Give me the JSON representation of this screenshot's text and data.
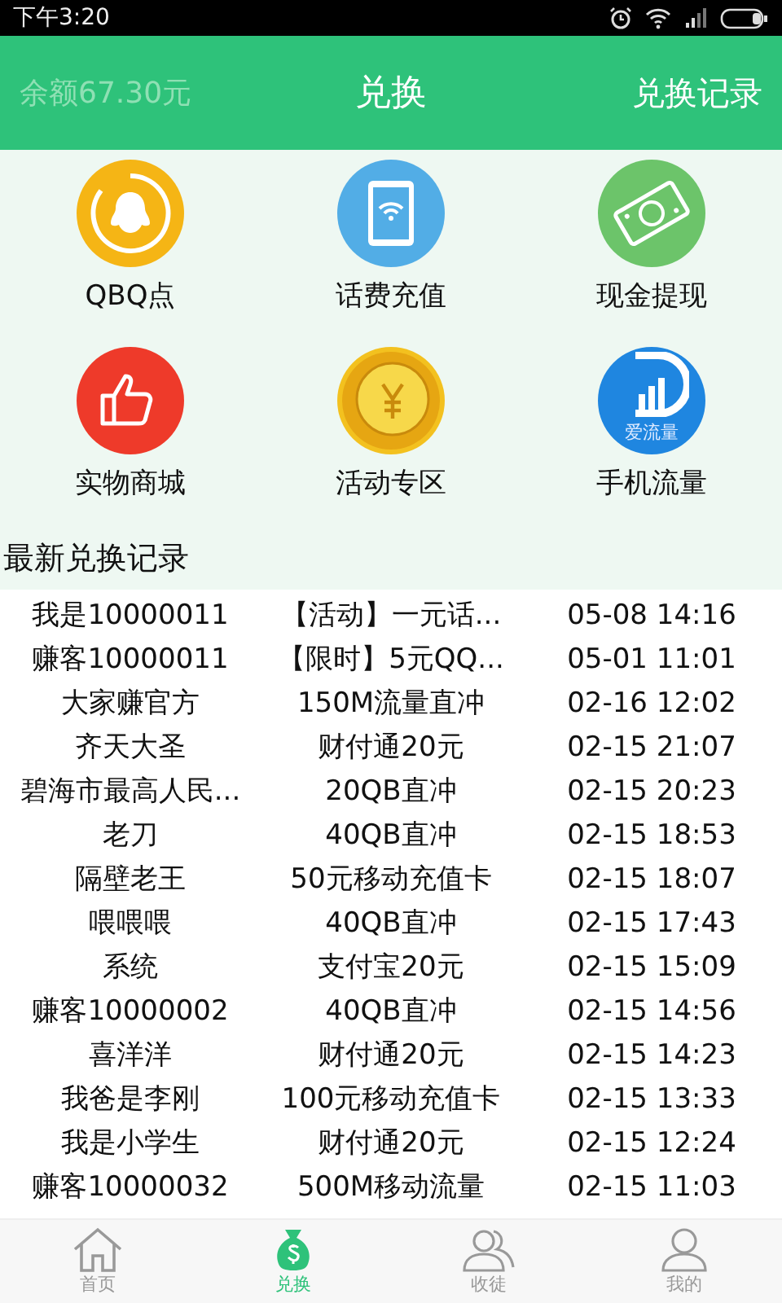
{
  "status_bar": {
    "time": "下午3:20"
  },
  "header": {
    "balance": "余额67.30元",
    "title": "兑换",
    "link": "兑换记录"
  },
  "categories": [
    {
      "label": "QBQ点",
      "kind": "qq",
      "color": "#f5b515"
    },
    {
      "label": "话费充值",
      "kind": "phone",
      "color": "#52ade6"
    },
    {
      "label": "现金提现",
      "kind": "cash",
      "color": "#6cc46a"
    },
    {
      "label": "实物商城",
      "kind": "thumb",
      "color": "#ee3a2a"
    },
    {
      "label": "活动专区",
      "kind": "coin",
      "color": "#f3c11f"
    },
    {
      "label": "手机流量",
      "kind": "data",
      "color": "#1f86e0",
      "caption": "爱流量"
    }
  ],
  "section_title": "最新兑换记录",
  "records": [
    {
      "user": "我是10000011",
      "item": "【活动】一元话...",
      "time": "05-08 14:16"
    },
    {
      "user": "赚客10000011",
      "item": "【限时】5元QQ...",
      "time": "05-01 11:01"
    },
    {
      "user": "大家赚官方",
      "item": "150M流量直冲",
      "time": "02-16 12:02"
    },
    {
      "user": "齐天大圣",
      "item": "财付通20元",
      "time": "02-15 21:07"
    },
    {
      "user": "碧海市最高人民...",
      "item": "20QB直冲",
      "time": "02-15 20:23"
    },
    {
      "user": "老刀",
      "item": "40QB直冲",
      "time": "02-15 18:53"
    },
    {
      "user": "隔壁老王",
      "item": "50元移动充值卡",
      "time": "02-15 18:07"
    },
    {
      "user": "喂喂喂",
      "item": "40QB直冲",
      "time": "02-15 17:43"
    },
    {
      "user": "系统",
      "item": "支付宝20元",
      "time": "02-15 15:09"
    },
    {
      "user": "赚客10000002",
      "item": "40QB直冲",
      "time": "02-15 14:56"
    },
    {
      "user": "喜洋洋",
      "item": "财付通20元",
      "time": "02-15 14:23"
    },
    {
      "user": "我爸是李刚",
      "item": "100元移动充值卡",
      "time": "02-15 13:33"
    },
    {
      "user": "我是小学生",
      "item": "财付通20元",
      "time": "02-15 12:24"
    },
    {
      "user": "赚客10000032",
      "item": "500M移动流量",
      "time": "02-15 11:03"
    }
  ],
  "nav": [
    {
      "label": "首页",
      "kind": "home",
      "selected": false
    },
    {
      "label": "兑换",
      "kind": "bag",
      "selected": true
    },
    {
      "label": "收徒",
      "kind": "people",
      "selected": false
    },
    {
      "label": "我的",
      "kind": "person",
      "selected": false
    }
  ]
}
